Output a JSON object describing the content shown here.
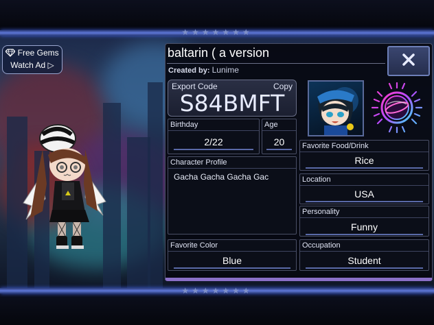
{
  "ui": {
    "free_gems_label": "Free Gems",
    "watch_ad_label": "Watch Ad ▷",
    "stars": "★★★★★★★",
    "close_glyph": "X"
  },
  "profile": {
    "name": "baltarin ( a version",
    "created_by_label": "Created by:",
    "created_by": "Lunime",
    "export_code_label": "Export Code",
    "export_code": "S84BMFT",
    "copy_label": "Copy",
    "birthday_label": "Birthday",
    "birthday": "2/22",
    "age_label": "Age",
    "age": "20",
    "character_profile_label": "Character Profile",
    "character_profile": "Gacha Gacha Gacha Gac",
    "favorite_color_label": "Favorite Color",
    "favorite_color": "Blue",
    "favorite_food_label": "Favorite Food/Drink",
    "favorite_food": "Rice",
    "location_label": "Location",
    "location": "USA",
    "personality_label": "Personality",
    "personality": "Funny",
    "occupation_label": "Occupation",
    "occupation": "Student"
  },
  "colors": {
    "accent": "#5f78d8",
    "panel_bg": "#0b0e18",
    "border": "#4a4f66"
  },
  "icons": [
    "diamond-icon",
    "close-icon",
    "portrait-image",
    "emblem-icon"
  ]
}
